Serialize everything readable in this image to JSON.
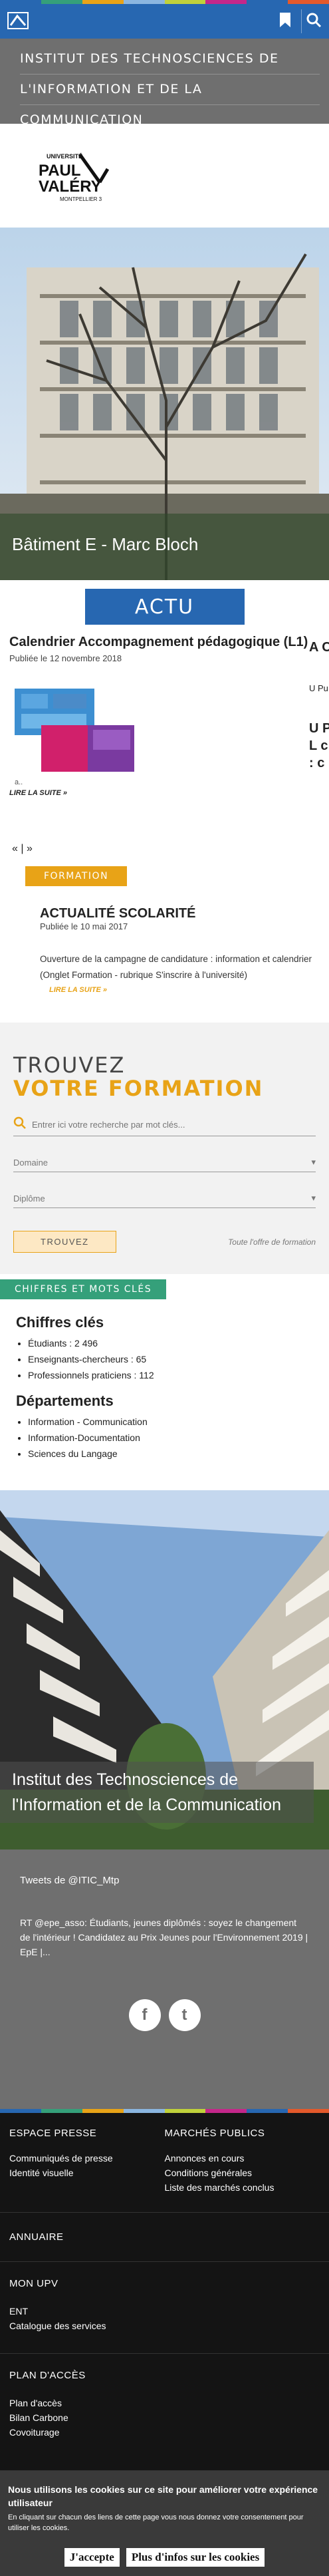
{
  "colors": {
    "bar": [
      "#2767b1",
      "#35a07a",
      "#e8a317",
      "#8bb6e0",
      "#c0d13b",
      "#c4278a",
      "#2767b1",
      "#e4592b"
    ],
    "primary": "#2767b1",
    "accent": "#e8a317",
    "teal": "#35a07a"
  },
  "header": {
    "bookmark_icon": "bookmark-icon",
    "search_icon": "search-icon",
    "site_title_lines": [
      "Institut des Technosciences de",
      "l'Information et de la",
      "Communication"
    ]
  },
  "logo": {
    "line1": "UNIVERSITÉ",
    "line2": "PAUL",
    "line3": "VALÉRY",
    "line4": "MONTPELLIER 3"
  },
  "hero": {
    "caption": "Bâtiment E - Marc Bloch"
  },
  "actu": {
    "heading": "ACTU",
    "item1": {
      "title": "Calendrier Accompagnement pédagogique (L1)",
      "date": "Publiée le 12 novembre 2018",
      "caption": "a..",
      "more": "LIRE LA SUITE »"
    },
    "peek1": "A C",
    "peek_meta": "U Pu",
    "peek2": "U P L c : c",
    "nav": {
      "prev": "«",
      "sep": "|",
      "next": "»"
    }
  },
  "news2": {
    "tag": "FORMATION",
    "title": "ACTUALITÉ SCOLARITÉ",
    "date": "Publiée le 10 mai 2017",
    "text": "Ouverture de la campagne de candidature : information et calendrier (Onglet Formation - rubrique S'inscrire à l'université)",
    "more": "LIRE LA SUITE »"
  },
  "trouvez": {
    "title1": "TROUVEZ",
    "title2": "VOTRE FORMATION",
    "search_placeholder": "Entrer ici votre recherche par mot clés...",
    "select1": "Domaine",
    "select2": "Diplôme",
    "button": "TROUVEZ",
    "all_link": "Toute l'offre de formation"
  },
  "chiffres": {
    "tag": "CHIFFRES ET MOTS CLÉS",
    "h1": "Chiffres clés",
    "list1": [
      "Étudiants : 2 496",
      "Enseignants-chercheurs : 65",
      "Professionnels praticiens : 112"
    ],
    "h2": "Départements",
    "list2": [
      "Information - Communication",
      "Information-Documentation",
      "Sciences du Langage"
    ]
  },
  "hero2": {
    "caption": "Institut des Technosciences de l'Information et de la Communication"
  },
  "tweets": {
    "title": "Tweets de @ITIC_Mtp",
    "text": "RT @epe_asso: Étudiants, jeunes diplômés : soyez le changement de l'intérieur ! Candidatez au Prix Jeunes pour l'Environnement 2019 | EpE |...",
    "fb": "f",
    "tw": "t"
  },
  "footer": {
    "col1_head": "ESPACE PRESSE",
    "col1": [
      "Communiqués de presse",
      "Identité visuelle"
    ],
    "col2_head": "MARCHÉS PUBLICS",
    "col2": [
      "Annonces en cours",
      "Conditions générales",
      "Liste des marchés conclus"
    ],
    "annuaire": "ANNUAIRE",
    "monupv": "MON UPV",
    "ent": "ENT",
    "catalogue": "Catalogue des services",
    "plan": "PLAN D'ACCÈS",
    "plan_links": [
      "Plan d'accès",
      "Bilan Carbone",
      "Covoiturage"
    ]
  },
  "cookies": {
    "title": "Nous utilisons les cookies sur ce site pour améliorer votre expérience utilisateur",
    "sub": "En cliquant sur chacun des liens de cette page vous nous donnez votre consentement pour utiliser les cookies.",
    "accept": "J'accepte",
    "more": "Plus d'infos sur les cookies"
  }
}
